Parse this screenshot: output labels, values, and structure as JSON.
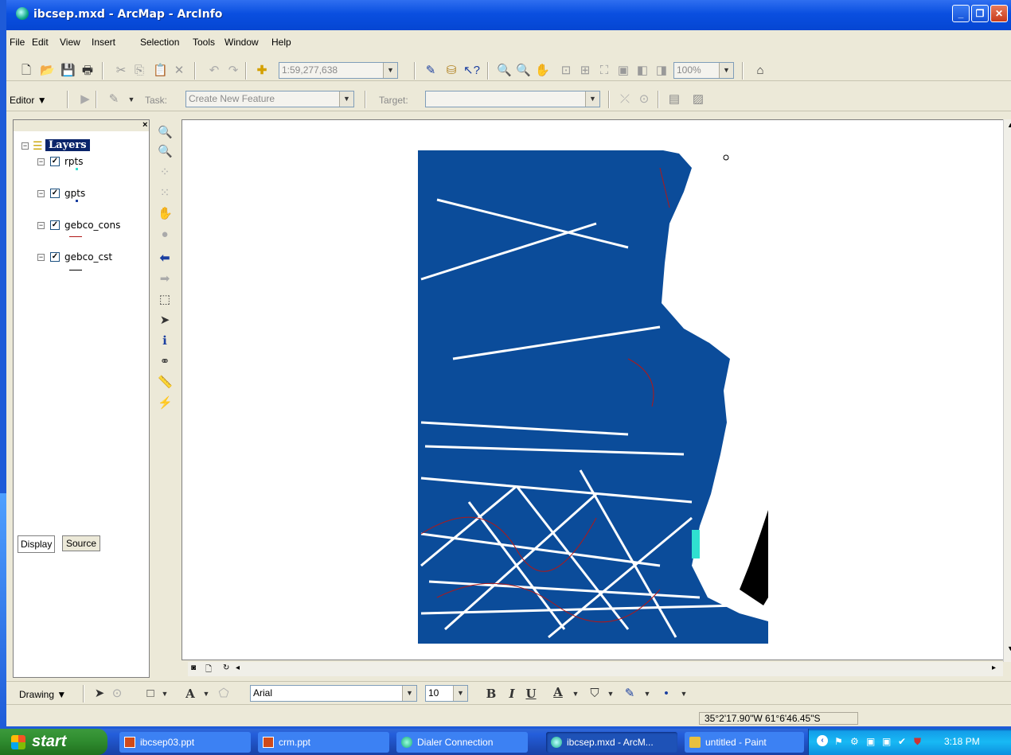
{
  "window": {
    "title": "ibcsep.mxd - ArcMap - ArcInfo"
  },
  "menu": [
    "File",
    "Edit",
    "View",
    "Insert",
    "Selection",
    "Tools",
    "Window",
    "Help"
  ],
  "standard_toolbar": {
    "scale": "1:59,277,638",
    "zoom": "100%"
  },
  "editor_toolbar": {
    "editor_label": "Editor",
    "task_label": "Task:",
    "task_value": "Create New Feature",
    "target_label": "Target:",
    "target_value": ""
  },
  "toc": {
    "root": "Layers",
    "layers": [
      {
        "name": "rpts",
        "symbol": "point-cyan"
      },
      {
        "name": "gpts",
        "symbol": "point-blue"
      },
      {
        "name": "gebco_cons",
        "symbol": "line-red"
      },
      {
        "name": "gebco_cst",
        "symbol": "line-black"
      }
    ],
    "tabs": [
      "Display",
      "Source"
    ]
  },
  "drawing_toolbar": {
    "drawing_label": "Drawing",
    "font": "Arial",
    "size": "10",
    "bold": "B",
    "italic": "I",
    "underline": "U",
    "text_color_letter": "A"
  },
  "status": {
    "coordinates": "35°2'17.90\"W  61°6'46.45\"S"
  },
  "taskbar": {
    "start": "start",
    "items": [
      {
        "label": "ibcsep03.ppt",
        "icon": "powerpoint-icon"
      },
      {
        "label": "crm.ppt",
        "icon": "powerpoint-icon"
      },
      {
        "label": "Dialer Connection",
        "icon": "globe-icon"
      },
      {
        "label": "ibcsep.mxd - ArcM...",
        "icon": "arcmap-icon",
        "active": true
      },
      {
        "label": "untitled - Paint",
        "icon": "paint-icon"
      }
    ],
    "clock": "3:18 PM"
  },
  "colors": {
    "map_tracks": "#0b4c9a",
    "contours": "#b01818",
    "coast": "#000000",
    "points": "#2fe0d0"
  }
}
